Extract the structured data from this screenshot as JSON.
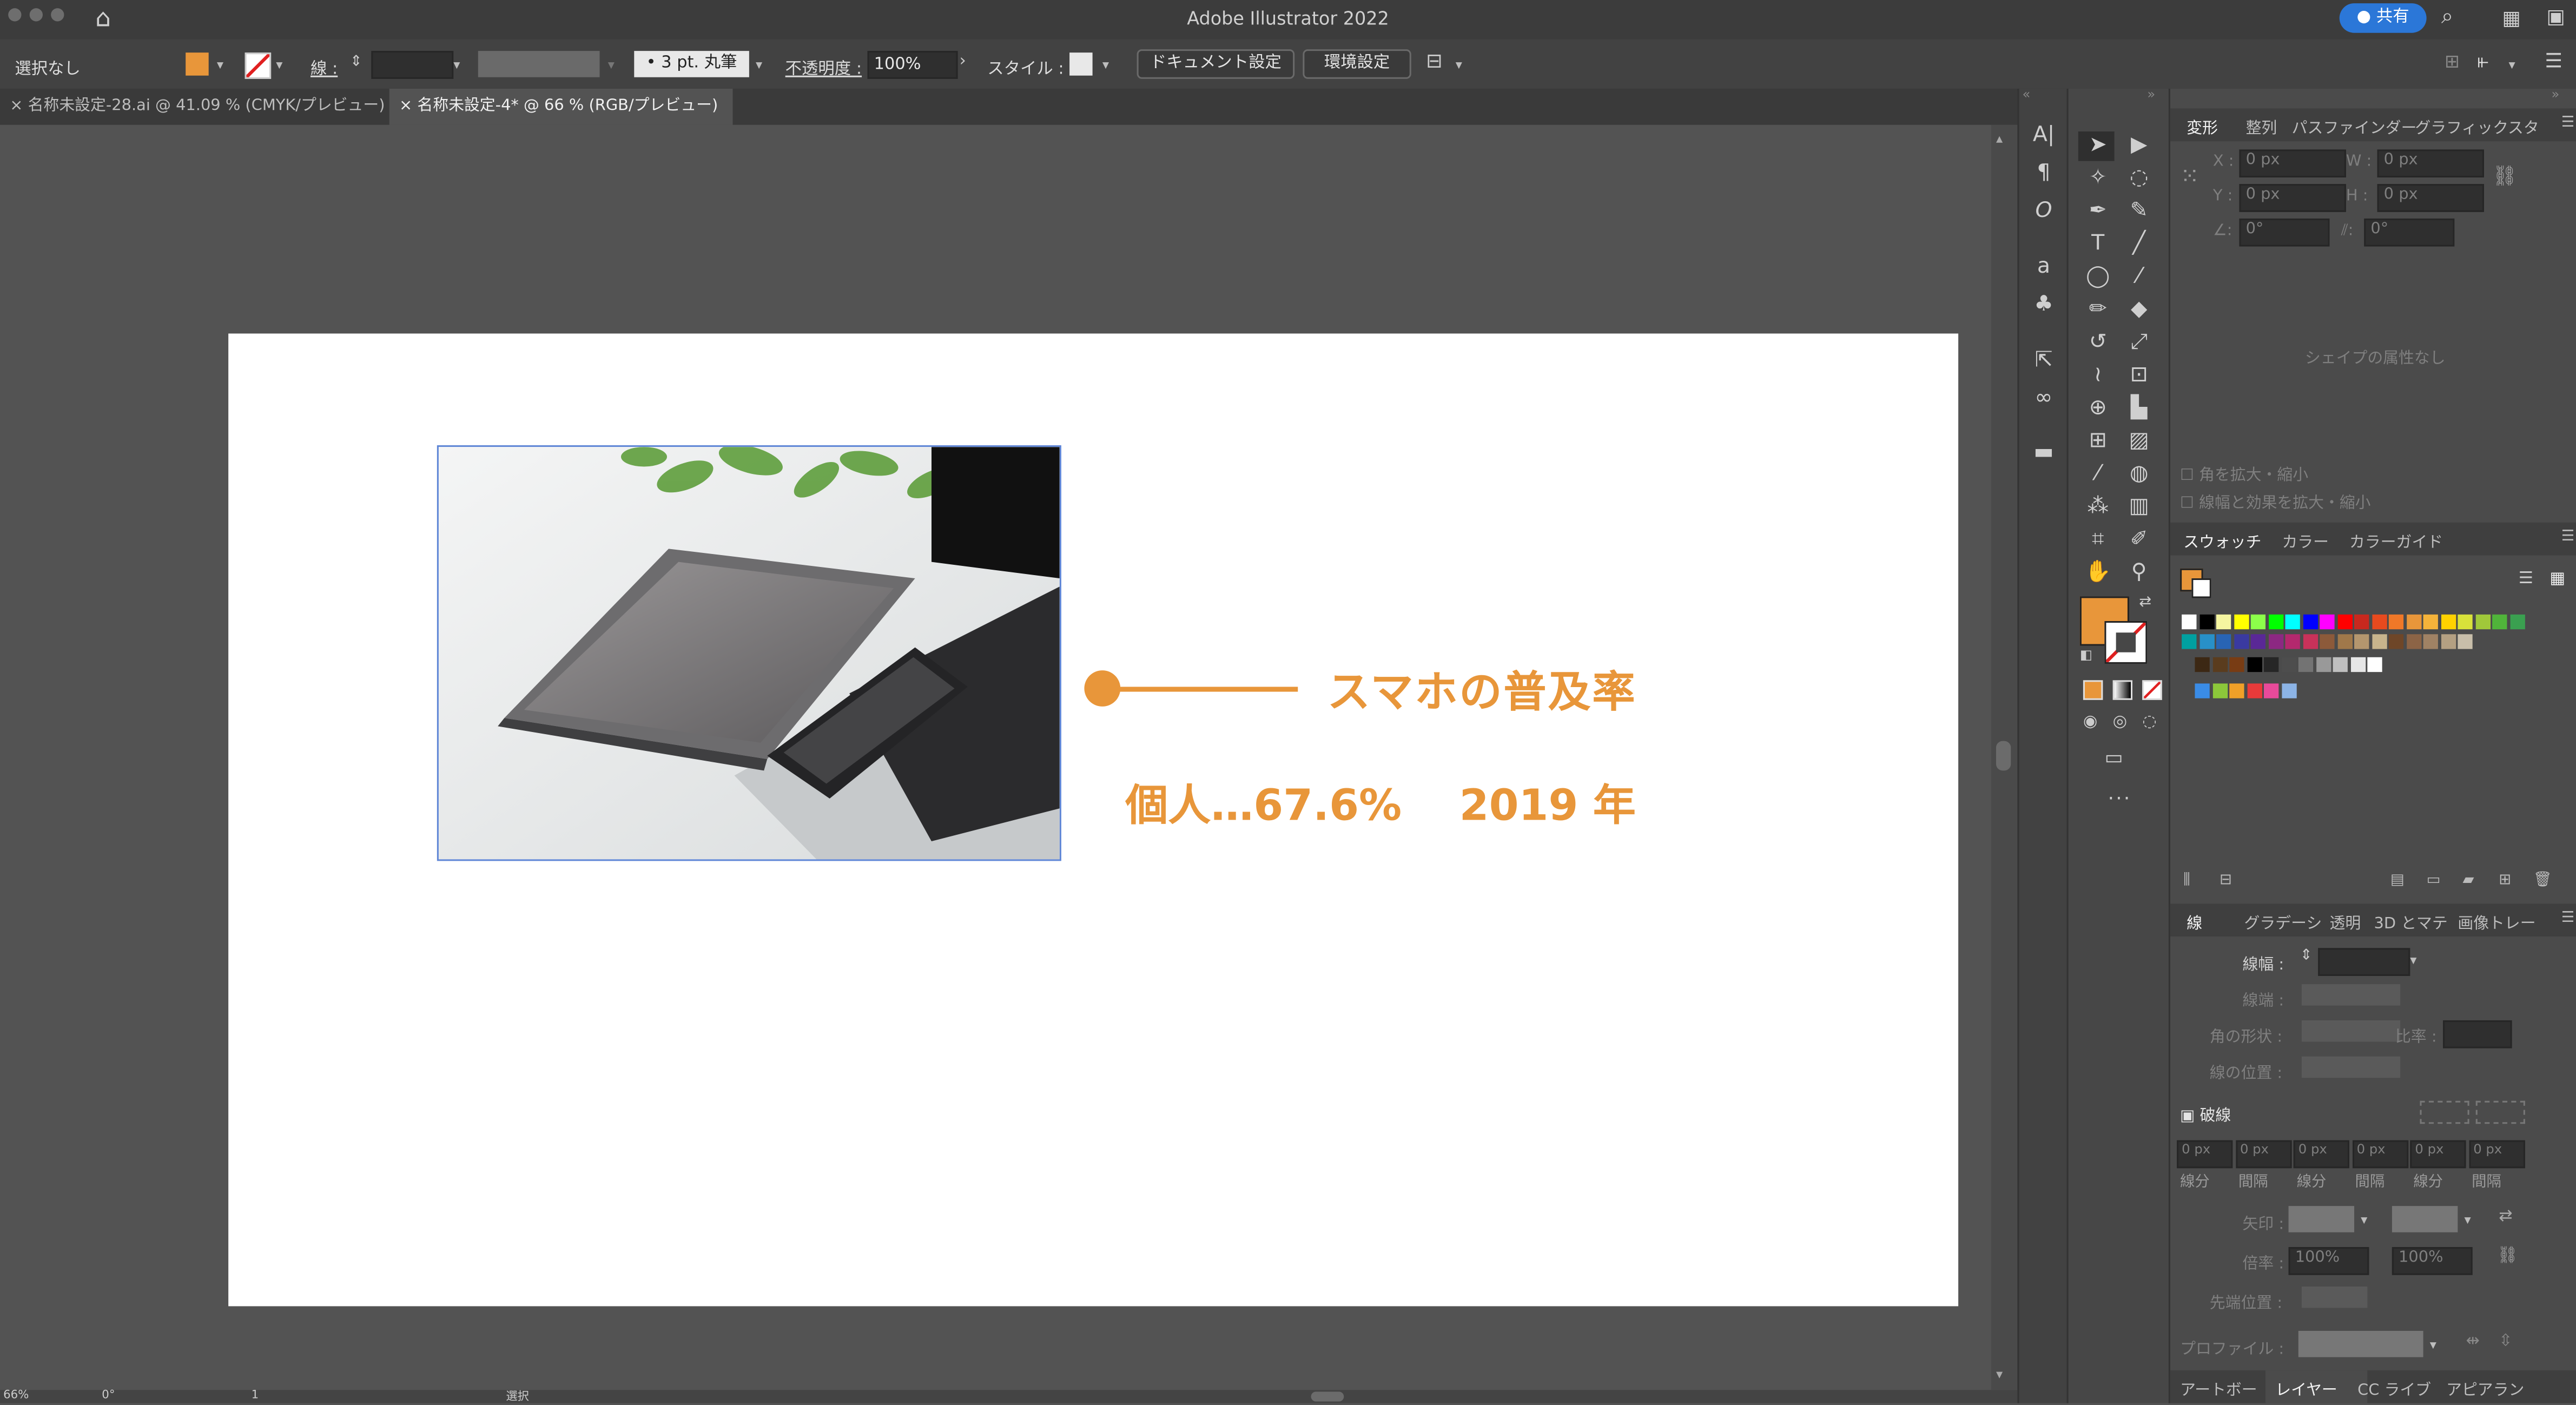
{
  "window": {
    "title": "Adobe Illustrator 2022",
    "share_label": "共有"
  },
  "control_bar": {
    "selection_label": "選択なし",
    "fill_color": "#e8963a",
    "stroke_label": "線 :",
    "brush_label": "3 pt. 丸筆",
    "opacity_label": "不透明度 :",
    "opacity_value": "100%",
    "style_label": "スタイル :",
    "document_setup_label": "ドキュメント設定",
    "preferences_label": "環境設定"
  },
  "document_tabs": [
    {
      "label": "名称未設定-28.ai @ 41.09 % (CMYK/プレビュー)",
      "active": false
    },
    {
      "label": "名称未設定-4* @ 66 % (RGB/プレビュー)",
      "active": true
    }
  ],
  "artboard": {
    "heading": "スマホの普及率",
    "stat_text": "個人…67.6%　 2019 年",
    "accent_color": "#e8963a",
    "photo_icon": "tablet-phone-laptop-photo"
  },
  "status_bar": {
    "zoom": "66%",
    "rotation": "0°",
    "artboard_number": "1",
    "tool_name": "選択"
  },
  "transform_panel": {
    "tabs": [
      "変形",
      "整列",
      "パスファインダー",
      "グラフィックスタ"
    ],
    "x_label": "X :",
    "y_label": "Y :",
    "w_label": "W :",
    "h_label": "H :",
    "x_value": "0 px",
    "y_value": "0 px",
    "w_value": "0 px",
    "h_value": "0 px",
    "angle_value": "0°",
    "shear_value": "0°",
    "no_shape_text": "シェイプの属性なし",
    "scale_corners_label": "角を拡大・縮小",
    "scale_strokes_label": "線幅と効果を拡大・縮小"
  },
  "swatches_panel": {
    "tabs": [
      "スウォッチ",
      "カラー",
      "カラーガイド"
    ],
    "colors_row1": [
      "#ffffff",
      "#000000",
      "#f5f5a0",
      "#ffff00",
      "#8cff4a",
      "#00ff00",
      "#00ffff",
      "#0000ff",
      "#ff00ff",
      "#ff0000",
      "#c8281e",
      "#e84a1e",
      "#f07828",
      "#e8963a",
      "#f5b33a",
      "#ffd200",
      "#d8e23a",
      "#a0c83a",
      "#50b43a",
      "#3aa050"
    ],
    "colors_row2": [
      "#00a0a0",
      "#2890c8",
      "#2864b4",
      "#3a3aa0",
      "#5a2896",
      "#8c2882",
      "#b4286e",
      "#c8325a",
      "#8c5a3a",
      "#a0784a",
      "#b4966e",
      "#c8b48c",
      "#6e4628",
      "#8c6446",
      "#a08264",
      "#b4a082",
      "#c8beaa"
    ],
    "colors_row3": [
      "#3c2814",
      "#5a3c1e",
      "#783c14",
      "#000000",
      "#262626",
      "#4d4d4d",
      "#737373",
      "#999999",
      "#bfbfbf",
      "#e6e6e6",
      "#ffffff"
    ],
    "colors_row4": [
      "#3a8ce6",
      "#8cc83a",
      "#f0a028",
      "#e83a3a",
      "#e84a9a",
      "#8cb4e6"
    ]
  },
  "stroke_panel": {
    "tabs": [
      "線",
      "グラデーシ",
      "透明",
      "3D とマテ",
      "画像トレー"
    ],
    "weight_label": "線幅 :",
    "cap_label": "線端 :",
    "corner_label": "角の形状 :",
    "limit_label": "比率 :",
    "align_label": "線の位置 :",
    "dashed_label": "破線",
    "dash_fields": [
      "線分",
      "間隔",
      "線分",
      "間隔",
      "線分",
      "間隔"
    ],
    "dash_values": [
      "0 px",
      "0 px",
      "0 px",
      "0 px",
      "0 px",
      "0 px"
    ],
    "arrow_label": "矢印 :",
    "scale_label": "倍率 :",
    "scale_values": [
      "100%",
      "100%"
    ],
    "align_arrow_label": "先端位置 :",
    "profile_label": "プロファイル :"
  },
  "bottom_tabs": [
    "アートボー",
    "レイヤー",
    "CC ライブ",
    "アピアラン"
  ]
}
